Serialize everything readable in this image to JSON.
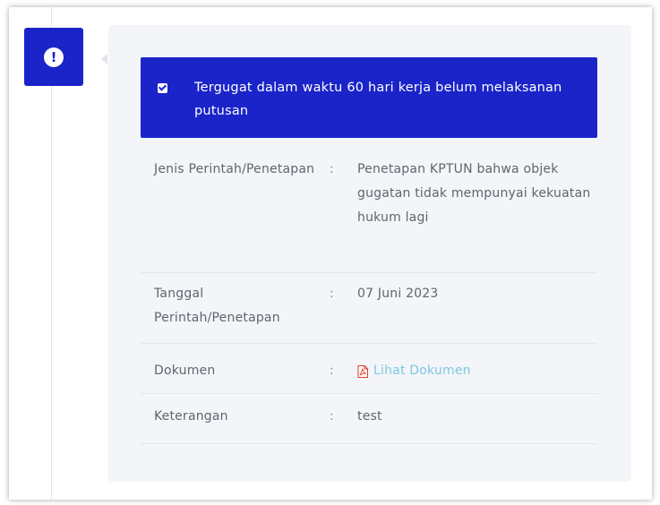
{
  "alert": {
    "checked": true,
    "text": "Tergugat dalam waktu 60 hari kerja belum melaksanan putusan"
  },
  "badge": {
    "icon": "exclamation-icon",
    "symbol": "!"
  },
  "details": [
    {
      "label": "Jenis Perintah/Penetapan",
      "separator": ":",
      "value": "Penetapan KPTUN bahwa objek gugatan tidak mempunyai kekuatan hukum lagi"
    },
    {
      "label": "Tanggal Perintah/Penetapan",
      "separator": ":",
      "value": "07 Juni 2023"
    },
    {
      "label": "Dokumen",
      "separator": ":",
      "value": "Lihat Dokumen",
      "icon": "pdf-icon"
    },
    {
      "label": "Keterangan",
      "separator": ":",
      "value": "test"
    }
  ],
  "colors": {
    "accent": "#1a24c9",
    "link": "#7fc6e4",
    "pdf_icon": "#e0362c",
    "card_bg": "#f3f5f8"
  }
}
